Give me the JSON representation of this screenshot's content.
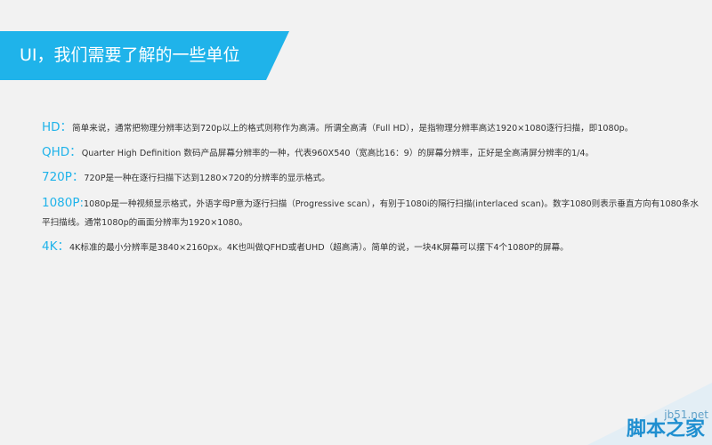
{
  "header": {
    "title": "UI，我们需要了解的一些单位"
  },
  "entries": [
    {
      "term": "HD：",
      "text": "简单来说，通常把物理分辨率达到720p以上的格式则称作为高清。所谓全高清（Full HD），是指物理分辨率高达1920×1080逐行扫描，即1080p。"
    },
    {
      "term": "QHD：",
      "text": "Quarter High Definition 数码产品屏幕分辨率的一种，代表960X540（宽高比16：9）的屏幕分辨率，正好是全高清屏分辨率的1/4。"
    },
    {
      "term": "720P：",
      "text": "720P是一种在逐行扫描下达到1280×720的分辨率的显示格式。"
    },
    {
      "term": "1080P:",
      "text": "1080p是一种视频显示格式，外语字母P意为逐行扫描（Progressive scan），有别于1080i的隔行扫描(interlaced scan)。数字1080则表示垂直方向有1080条水平扫描线。通常1080p的画面分辨率为1920×1080。"
    },
    {
      "term": "4K：",
      "text": "4K标准的最小分辨率是3840×2160px。4K也叫做QFHD或者UHD（超高清）。简单的说，一块4K屏幕可以摆下4个1080P的屏幕。"
    }
  ],
  "watermark": {
    "sub": "jb51.net",
    "main": "脚本之家"
  }
}
